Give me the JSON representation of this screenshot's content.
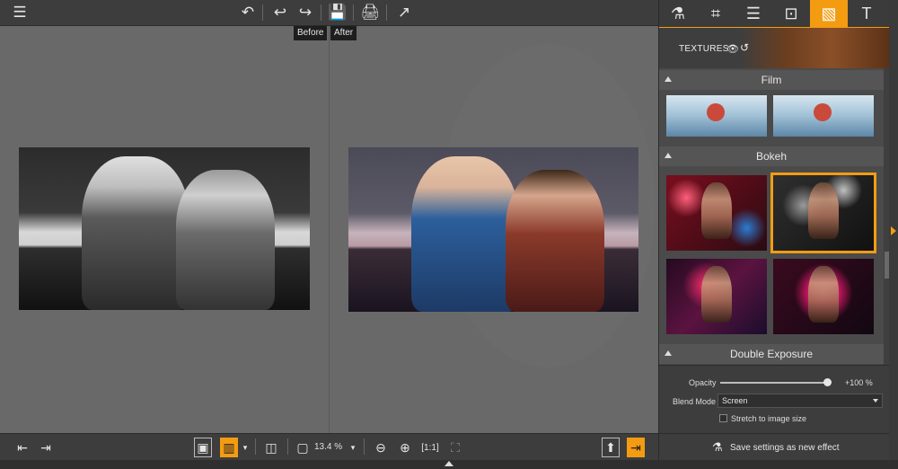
{
  "toolbar": {
    "tooltip_before": "Before",
    "tooltip_after": "After",
    "icons": {
      "menu": "☰",
      "undo_all": "↶",
      "undo": "↩",
      "redo": "↪",
      "save": "💾",
      "print": "🖨",
      "share": "↗"
    }
  },
  "bottom": {
    "zoom_label": "13.4 %"
  },
  "panel": {
    "tabs": [
      {
        "icon": "⚗"
      },
      {
        "icon": "⌗"
      },
      {
        "icon": "☰"
      },
      {
        "icon": "⊡"
      },
      {
        "icon": "▧"
      },
      {
        "icon": "T"
      }
    ],
    "textures_label": "TEXTURES",
    "eye_icon": "👁",
    "reset_icon": "↺",
    "sections": {
      "film": "Film",
      "bokeh": "Bokeh",
      "double_exposure": "Double Exposure"
    },
    "controls": {
      "opacity_label": "Opacity",
      "opacity_value": "+100 %",
      "blend_mode_label": "Blend Mode",
      "blend_mode_value": "Screen",
      "stretch_label": "Stretch to image size"
    },
    "save_label": "Save settings as new effect"
  },
  "colors": {
    "accent": "#f39c12",
    "panel_bg": "#4a4a4a",
    "canvas_bg": "#696969"
  }
}
